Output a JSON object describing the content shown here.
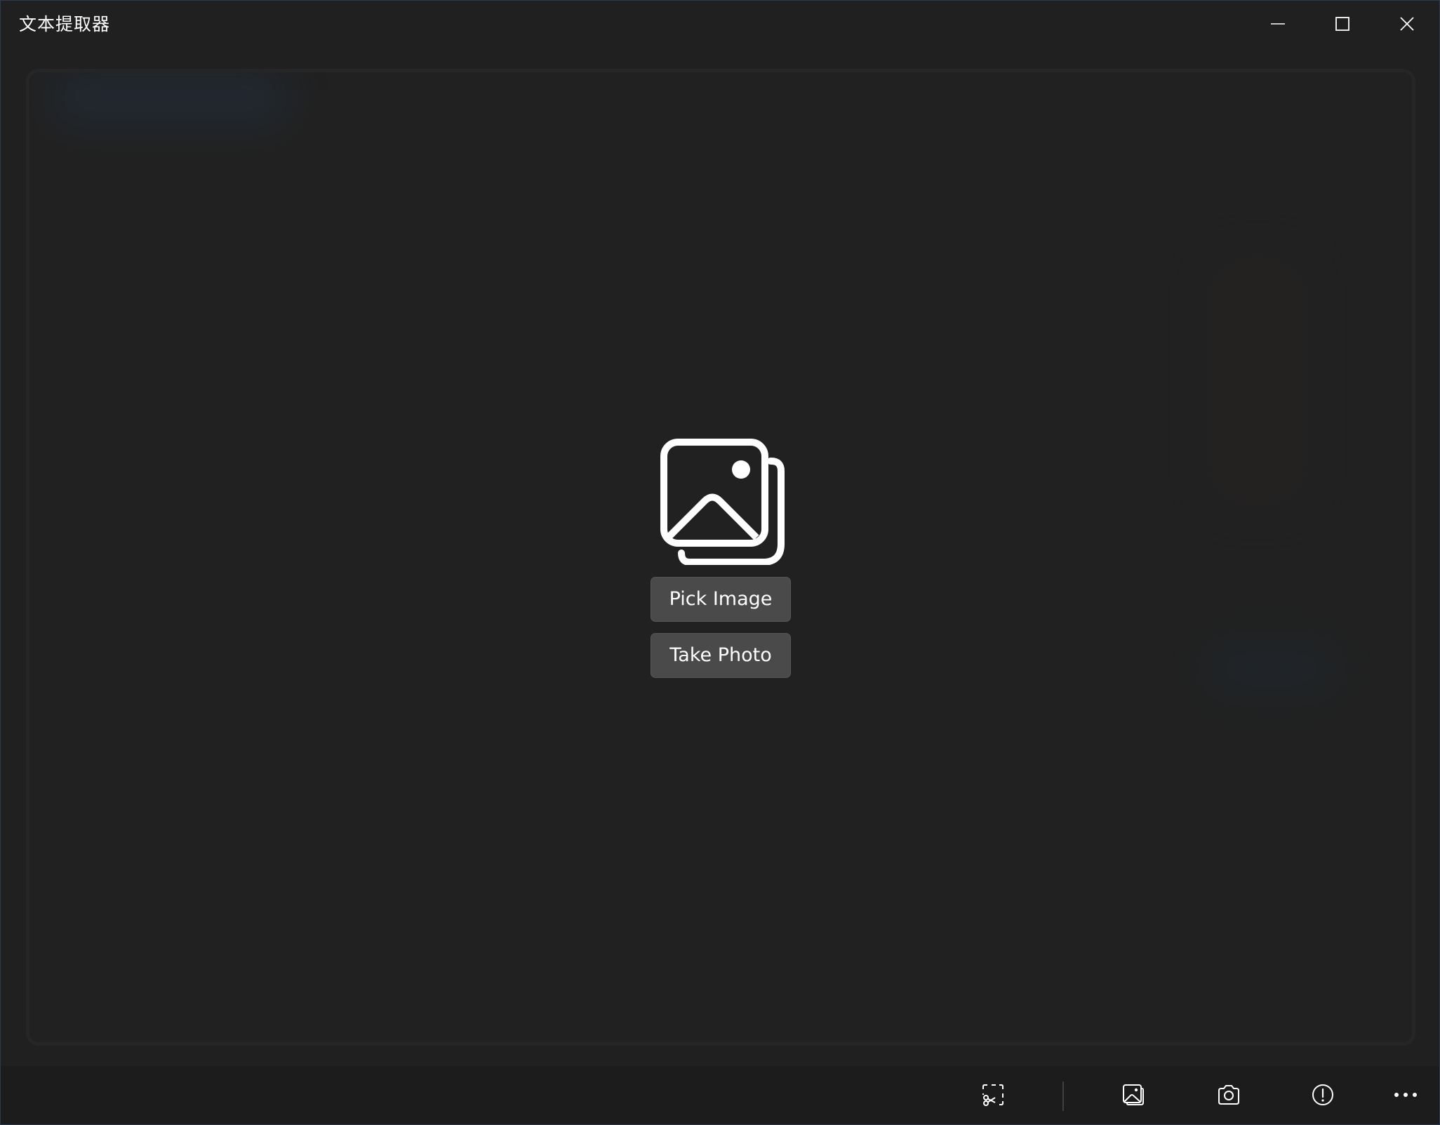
{
  "window": {
    "title": "文本提取器"
  },
  "titlebar": {
    "minimize_icon": "minimize-icon",
    "maximize_icon": "maximize-icon",
    "close_icon": "close-icon"
  },
  "main": {
    "hero_icon": "image-gallery-icon",
    "pick_image_label": "Pick Image",
    "take_photo_label": "Take Photo"
  },
  "toolbar": {
    "items": [
      {
        "icon": "snip-scissors-icon"
      },
      {
        "icon": "image-icon"
      },
      {
        "icon": "camera-icon"
      },
      {
        "icon": "info-icon"
      },
      {
        "icon": "more-icon"
      }
    ]
  },
  "colors": {
    "background": "#202020",
    "button": "#4a4a4a",
    "foreground": "#ffffff",
    "toolbar": "#1c1c1c"
  }
}
